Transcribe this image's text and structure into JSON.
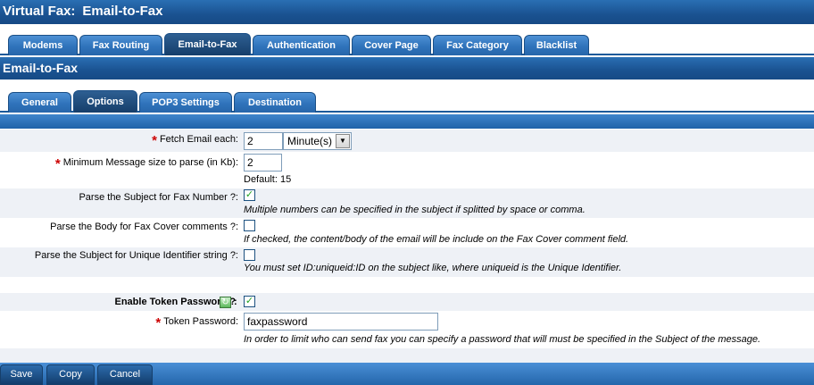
{
  "window": {
    "app": "Virtual Fax:",
    "title": "Email-to-Fax"
  },
  "top_tabs": [
    {
      "label": "Modems"
    },
    {
      "label": "Fax Routing"
    },
    {
      "label": "Email-to-Fax",
      "active": true
    },
    {
      "label": "Authentication"
    },
    {
      "label": "Cover Page"
    },
    {
      "label": "Fax Category"
    },
    {
      "label": "Blacklist"
    }
  ],
  "section": {
    "title": "Email-to-Fax"
  },
  "sub_tabs": [
    {
      "label": "General"
    },
    {
      "label": "Options",
      "active": true
    },
    {
      "label": "POP3 Settings"
    },
    {
      "label": "Destination"
    }
  ],
  "form": {
    "fetch": {
      "label": "Fetch Email each:",
      "value": "2",
      "unit": "Minute(s)"
    },
    "min_size": {
      "label": "Minimum Message size to parse (in Kb):",
      "value": "2",
      "default_text": "Default: 15"
    },
    "parse_subject": {
      "label": "Parse the Subject for Fax Number ?:",
      "checked": true,
      "help": "Multiple numbers can be specified in the subject if splitted by space or comma."
    },
    "parse_body": {
      "label": "Parse the Body for Fax Cover comments ?:",
      "checked": false,
      "help": "If checked, the content/body of the email will be include on the Fax Cover comment field."
    },
    "parse_uid": {
      "label": "Parse the Subject for Unique Identifier string ?:",
      "checked": false,
      "help": "You must set ID:uniqueid:ID on the subject like, where uniqueid is the Unique Identifier."
    },
    "enable_token": {
      "label": "Enable Token Password ?",
      "colon": ":",
      "checked": true
    },
    "token": {
      "label": "Token Password:",
      "value": "faxpassword",
      "help": "In order to limit who can send fax you can specify a password that will must be specified in the Subject of the message."
    }
  },
  "buttons": {
    "save": "Save",
    "copy": "Copy",
    "cancel": "Cancel"
  },
  "colors": {
    "header_blue": "#1a5291",
    "required_star": "#cc0000",
    "check_green": "#21a121"
  }
}
